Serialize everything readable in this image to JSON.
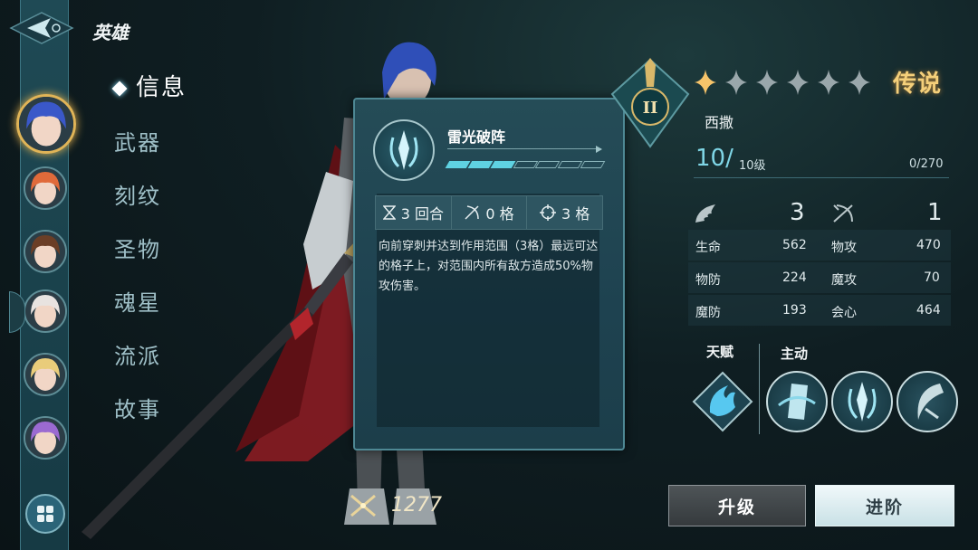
{
  "header": {
    "title": "英雄",
    "back_icon": "back-arrow-icon"
  },
  "sidebar": {
    "avatars": [
      {
        "name": "hero-avatar-1",
        "selected": true,
        "hair": "#3a58c9"
      },
      {
        "name": "hero-avatar-2",
        "selected": false,
        "hair": "#e06a3a"
      },
      {
        "name": "hero-avatar-3",
        "selected": false,
        "hair": "#6b3e26"
      },
      {
        "name": "hero-avatar-4",
        "selected": false,
        "hair": "#e8e3e0"
      },
      {
        "name": "hero-avatar-5",
        "selected": false,
        "hair": "#e9cc7a"
      },
      {
        "name": "hero-avatar-6",
        "selected": false,
        "hair": "#9b6ad1"
      }
    ],
    "grid_icon": "grid-icon"
  },
  "menu": {
    "items": [
      {
        "label": "信息",
        "active": true
      },
      {
        "label": "武器",
        "active": false
      },
      {
        "label": "刻纹",
        "active": false
      },
      {
        "label": "圣物",
        "active": false
      },
      {
        "label": "魂星",
        "active": false
      },
      {
        "label": "流派",
        "active": false
      },
      {
        "label": "故事",
        "active": false
      }
    ]
  },
  "skill_popup": {
    "name": "雷光破阵",
    "level_filled": 3,
    "level_total": 7,
    "stats": [
      {
        "icon": "hourglass-icon",
        "value": "3 回合"
      },
      {
        "icon": "bow-icon",
        "value": "0 格"
      },
      {
        "icon": "crosshair-icon",
        "value": "3 格"
      }
    ],
    "description": "向前穿刺并达到作用范围（3格）最远可达的格子上，对范围内所有敌方造成50%物攻伤害。"
  },
  "hero": {
    "class_roman": "II",
    "stars_total": 6,
    "stars_lit": 1,
    "rank": "传说",
    "name": "西撒",
    "level": "10/",
    "level_cap": "10级",
    "exp": "0/270",
    "move": "3",
    "range": "1",
    "attributes": [
      {
        "label": "生命",
        "value": "562"
      },
      {
        "label": "物攻",
        "value": "470"
      },
      {
        "label": "物防",
        "value": "224"
      },
      {
        "label": "魔攻",
        "value": "70"
      },
      {
        "label": "魔防",
        "value": "193"
      },
      {
        "label": "会心",
        "value": "464"
      }
    ]
  },
  "skills": {
    "talent_label": "天赋",
    "active_label": "主动",
    "talent_icon": "flame-wing-icon",
    "active_icons": [
      "banner-swirl-icon",
      "lance-burst-icon",
      "crescent-blade-icon"
    ]
  },
  "footer": {
    "power": "1277",
    "power_icon": "crossed-swords-icon",
    "upgrade_label": "升级",
    "advance_label": "进阶"
  },
  "colors": {
    "accent": "#5fd2e2",
    "gold": "#f4cf7a",
    "panel": "#254c57"
  }
}
